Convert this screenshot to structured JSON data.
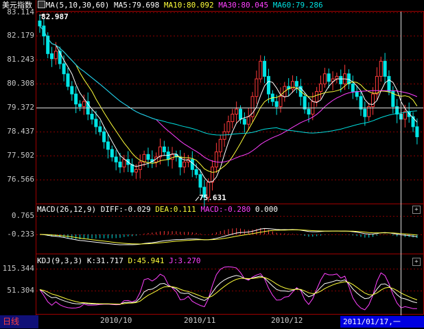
{
  "title": "美元指数",
  "colors": {
    "background": "#000000",
    "grid": "#8b0000",
    "up": "#ff3a3a",
    "down": "#00e5e5",
    "ma5": "#ffffff",
    "ma10": "#ffff3a",
    "ma30": "#ff40ff",
    "ma60": "#00e0e0"
  },
  "price_panel": {
    "indicator_icon": "ma-settings-icon",
    "ma_params": "MA(5,10,30,60)",
    "ma5": "MA5:79.698",
    "ma10": "MA10:80.092",
    "ma30": "MA30:80.045",
    "ma60": "MA60:79.286",
    "high_label": "82.987",
    "low_label": "75.631",
    "y_ticks": [
      "83.114",
      "82.179",
      "81.243",
      "80.308",
      "79.372",
      "78.437",
      "77.502",
      "76.566"
    ]
  },
  "macd_panel": {
    "params": "MACD(26,12,9)",
    "diff": "DIFF:-0.029",
    "dea": "DEA:0.111",
    "macd": "MACD:-0.280",
    "zero": "0.000",
    "y_ticks": [
      "0.765",
      "-0.233"
    ],
    "toggle_icon": "+"
  },
  "kdj_panel": {
    "params": "KDJ(9,3,3)",
    "k": "K:31.717",
    "d": "D:45.941",
    "j": "J:3.270",
    "y_ticks": [
      "115.344",
      "51.304"
    ],
    "toggle_icon": "+"
  },
  "x_axis": {
    "period": "日线",
    "months": [
      "2010/10",
      "2010/11",
      "2010/12"
    ],
    "cursor_date": "2011/01/17,一"
  },
  "chart_data": [
    {
      "type": "candlestick",
      "title": "美元指数",
      "series": [
        {
          "name": "MA5",
          "value": 79.698
        },
        {
          "name": "MA10",
          "value": 80.092
        },
        {
          "name": "MA30",
          "value": 80.045
        },
        {
          "name": "MA60",
          "value": 79.286
        }
      ],
      "ylim": [
        75.631,
        83.114
      ],
      "annotations": [
        "82.987",
        "75.631"
      ],
      "closes": [
        82.6,
        82.2,
        81.5,
        81.3,
        81.6,
        81.1,
        80.7,
        80.2,
        79.9,
        79.5,
        79.4,
        79.6,
        79.1,
        78.9,
        78.6,
        78.4,
        78.0,
        77.7,
        77.4,
        77.2,
        77.0,
        77.3,
        77.1,
        76.8,
        76.9,
        77.2,
        77.5,
        77.3,
        77.2,
        77.4,
        77.8,
        77.6,
        77.3,
        77.5,
        77.4,
        77.0,
        77.2,
        77.3,
        76.9,
        76.7,
        76.2,
        75.8,
        76.4,
        77.0,
        77.6,
        78.1,
        78.4,
        78.8,
        79.1,
        79.3,
        78.9,
        78.7,
        79.0,
        79.8,
        80.5,
        81.2,
        80.6,
        79.9,
        79.6,
        79.4,
        79.8,
        80.2,
        80.1,
        80.4,
        80.2,
        79.8,
        79.3,
        79.1,
        79.6,
        80.0,
        80.3,
        80.7,
        80.4,
        80.5,
        80.6,
        80.3,
        80.7,
        80.3,
        80.0,
        79.8,
        79.3,
        79.0,
        79.4,
        79.9,
        80.6,
        81.2,
        80.6,
        80.0,
        79.4,
        79.1,
        78.9,
        79.2,
        79.0,
        78.6,
        78.2
      ]
    },
    {
      "type": "line",
      "title": "MACD(26,12,9)",
      "series": [
        {
          "name": "DIFF",
          "last": -0.029
        },
        {
          "name": "DEA",
          "last": 0.111
        },
        {
          "name": "MACD",
          "last": -0.28
        }
      ],
      "y_ticks": [
        0.765,
        -0.233
      ]
    },
    {
      "type": "line",
      "title": "KDJ(9,3,3)",
      "series": [
        {
          "name": "K",
          "last": 31.717
        },
        {
          "name": "D",
          "last": 45.941
        },
        {
          "name": "J",
          "last": 3.27
        }
      ],
      "y_ticks": [
        115.344,
        51.304
      ]
    }
  ]
}
